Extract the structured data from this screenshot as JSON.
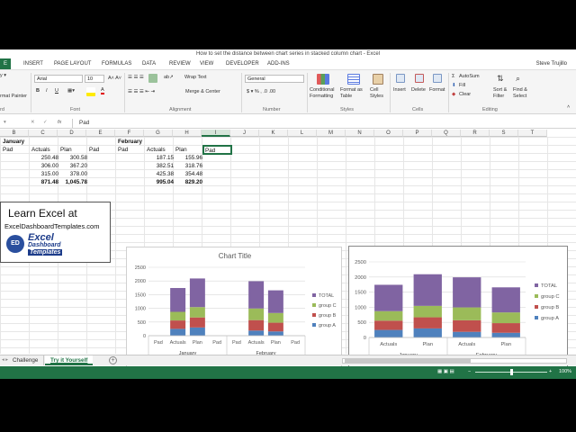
{
  "window_title": "How to set the distance between chart series in stacked column chart - Excel",
  "user": "Steve Trujillo",
  "ribbon_tabs": [
    "E",
    "INSERT",
    "PAGE LAYOUT",
    "FORMULAS",
    "DATA",
    "REVIEW",
    "VIEW",
    "DEVELOPER",
    "ADD-INS"
  ],
  "ribbon": {
    "format_painter": "rmat Painter",
    "font_name": "Arial",
    "font_size": "10",
    "wrap_text": "Wrap Text",
    "merge_center": "Merge & Center",
    "number_format": "General",
    "conditional_formatting": "Conditional Formatting",
    "format_as_table": "Format as Table",
    "cell_styles": "Cell Styles",
    "insert": "Insert",
    "delete": "Delete",
    "format": "Format",
    "autosum": "AutoSum",
    "fill": "Fill",
    "clear": "Clear",
    "sort_filter": "Sort & Filter",
    "find_select": "Find & Select",
    "groups": {
      "font": "Font",
      "alignment": "Alignment",
      "number": "Number",
      "styles": "Styles",
      "cells": "Cells",
      "editing": "Editing",
      "clipboard": "rd"
    }
  },
  "formula_bar": {
    "fx": "fx",
    "value": "Pad"
  },
  "columns": [
    "B",
    "C",
    "D",
    "E",
    "F",
    "G",
    "H",
    "I",
    "J",
    "K",
    "L",
    "M",
    "N",
    "O",
    "P",
    "Q",
    "R",
    "S",
    "T"
  ],
  "table": {
    "month1": "January",
    "month2": "February",
    "headers": [
      "Pad",
      "Actuals",
      "Plan",
      "Pad",
      "Pad",
      "Actuals",
      "Plan",
      "Pad"
    ],
    "rows": [
      [
        "250.48",
        "300.58",
        "187.15",
        "155.96"
      ],
      [
        "306.00",
        "367.20",
        "382.51",
        "318.76"
      ],
      [
        "315.00",
        "378.00",
        "425.38",
        "354.48"
      ]
    ],
    "totals": [
      "871.48",
      "1,045.78",
      "995.04",
      "829.20"
    ]
  },
  "promo": {
    "line1": "Learn Excel at",
    "line2": "ExcelDashboardTemplates.com",
    "logo_word1": "Excel",
    "logo_word2": "Dashboard",
    "logo_word3": "Templates",
    "logo_badge": "ED"
  },
  "sheets": [
    "Challenge",
    "Try it Yourself"
  ],
  "zoom": "100%",
  "chart_data": [
    {
      "type": "bar",
      "title": "Chart Title",
      "stacked": true,
      "categories": [
        "Pad",
        "Actuals",
        "Plan",
        "Pad",
        "Pad",
        "Actuals",
        "Plan",
        "Pad"
      ],
      "groups": [
        "January",
        "February"
      ],
      "ylim": [
        0,
        2500
      ],
      "yticks": [
        "0",
        "500",
        "1000",
        "1500",
        "2000",
        "2500"
      ],
      "series": [
        {
          "name": "group A",
          "color": "#4f81bd",
          "values": [
            0,
            250.48,
            300.58,
            0,
            0,
            187.15,
            155.96,
            0
          ]
        },
        {
          "name": "group B",
          "color": "#c0504d",
          "values": [
            0,
            306.0,
            367.2,
            0,
            0,
            382.51,
            318.76,
            0
          ]
        },
        {
          "name": "group C",
          "color": "#9bbb59",
          "values": [
            0,
            315.0,
            378.0,
            0,
            0,
            425.38,
            354.48,
            0
          ]
        },
        {
          "name": "TOTAL",
          "color": "#8064a2",
          "values": [
            0,
            871.48,
            1045.78,
            0,
            0,
            995.04,
            829.2,
            0
          ]
        }
      ],
      "legend": [
        "TOTAL",
        "group C",
        "group B",
        "group A"
      ],
      "legend_position": "right"
    },
    {
      "type": "bar",
      "title": "",
      "stacked": true,
      "categories": [
        "Actuals",
        "Plan",
        "Actuals",
        "Plan"
      ],
      "groups": [
        "January",
        "February"
      ],
      "ylim": [
        0,
        2500
      ],
      "yticks": [
        "0",
        "500",
        "1000",
        "1500",
        "2000",
        "2500"
      ],
      "series": [
        {
          "name": "group A",
          "color": "#4f81bd",
          "values": [
            250.48,
            300.58,
            187.15,
            155.96
          ]
        },
        {
          "name": "group B",
          "color": "#c0504d",
          "values": [
            306.0,
            367.2,
            382.51,
            318.76
          ]
        },
        {
          "name": "group C",
          "color": "#9bbb59",
          "values": [
            315.0,
            378.0,
            425.38,
            354.48
          ]
        },
        {
          "name": "TOTAL",
          "color": "#8064a2",
          "values": [
            871.48,
            1045.78,
            995.04,
            829.2
          ]
        }
      ],
      "legend": [
        "TOTAL",
        "group C",
        "group B",
        "group A"
      ],
      "legend_position": "right"
    }
  ]
}
